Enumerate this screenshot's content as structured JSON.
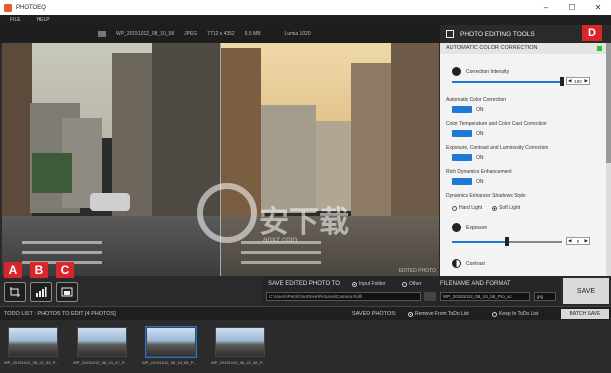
{
  "window": {
    "title": "PHOTOEQ",
    "minimize": "–",
    "maximize": "☐",
    "close": "✕"
  },
  "menu": [
    "FILE",
    "HELP"
  ],
  "image_info": {
    "filename": "WP_20151012_08_10_58",
    "format": "JPEG",
    "dimensions": "7712 x 4352",
    "size": "6.5 MB",
    "camera": "Lumia 1020"
  },
  "preview": {
    "edited_label": "EDITED PHOTO",
    "watermark_text": "安下载",
    "watermark_sub": "anxz.com"
  },
  "tools": {
    "labels": [
      "A",
      "B",
      "C"
    ],
    "icons": [
      "crop-icon",
      "histogram-icon",
      "compare-icon"
    ]
  },
  "save": {
    "title": "SAVE EDITED PHOTO TO",
    "option_input_folder": "Input Folder",
    "option_other": "Other",
    "path": "C:\\Users\\Petri\\OneDrive\\Pictures\\Camera Roll\\",
    "filename_title": "FILENAME AND FORMAT",
    "filename_value": "WP_20151012_08_10_58_Pro_sc",
    "format_value": "jpg",
    "save_button": "SAVE"
  },
  "todo": {
    "title": "TODO LIST : PHOTOS TO EDIT  [4 PHOTOS]",
    "saved_label": "SAVED PHOTOS:",
    "option_remove": "Remove From ToDo List",
    "option_keep": "Keep In ToDo List",
    "batch_button": "BATCH SAVE",
    "thumbnails": [
      "WP_20151012_08_22_53_P...",
      "WP_20151012_08_10_47_P...",
      "WP_20151012_08_10_58_P...",
      "WP_20151012_08_22_46_P..."
    ]
  },
  "panel": {
    "title": "PHOTO EDITING TOOLS",
    "badge": "D",
    "section": "AUTOMATIC COLOR CORRECTION",
    "correction_intensity_label": "Correction Intensity",
    "correction_intensity_value": "100",
    "correction_intensity_level": 1.0,
    "auto_color_label": "Automatic Color Correction",
    "auto_color_state": "ON",
    "color_temp_label": "Color Temperature and Color Cast Correction",
    "color_temp_state": "ON",
    "exposure_contrast_label": "Exposure, Contrast and Luminosity Correction",
    "exposure_contrast_state": "ON",
    "rich_dynamics_label": "Rich Dynamics Enhancement",
    "rich_dynamics_state": "ON",
    "shadows_style_label": "Dynamics Enhancer Shadows Style:",
    "hard_light": "Hard Light",
    "soft_light": "Soft Light",
    "exposure_label": "Exposure",
    "exposure_value": "0",
    "exposure_level": 0.5,
    "contrast_label": "Contrast"
  }
}
